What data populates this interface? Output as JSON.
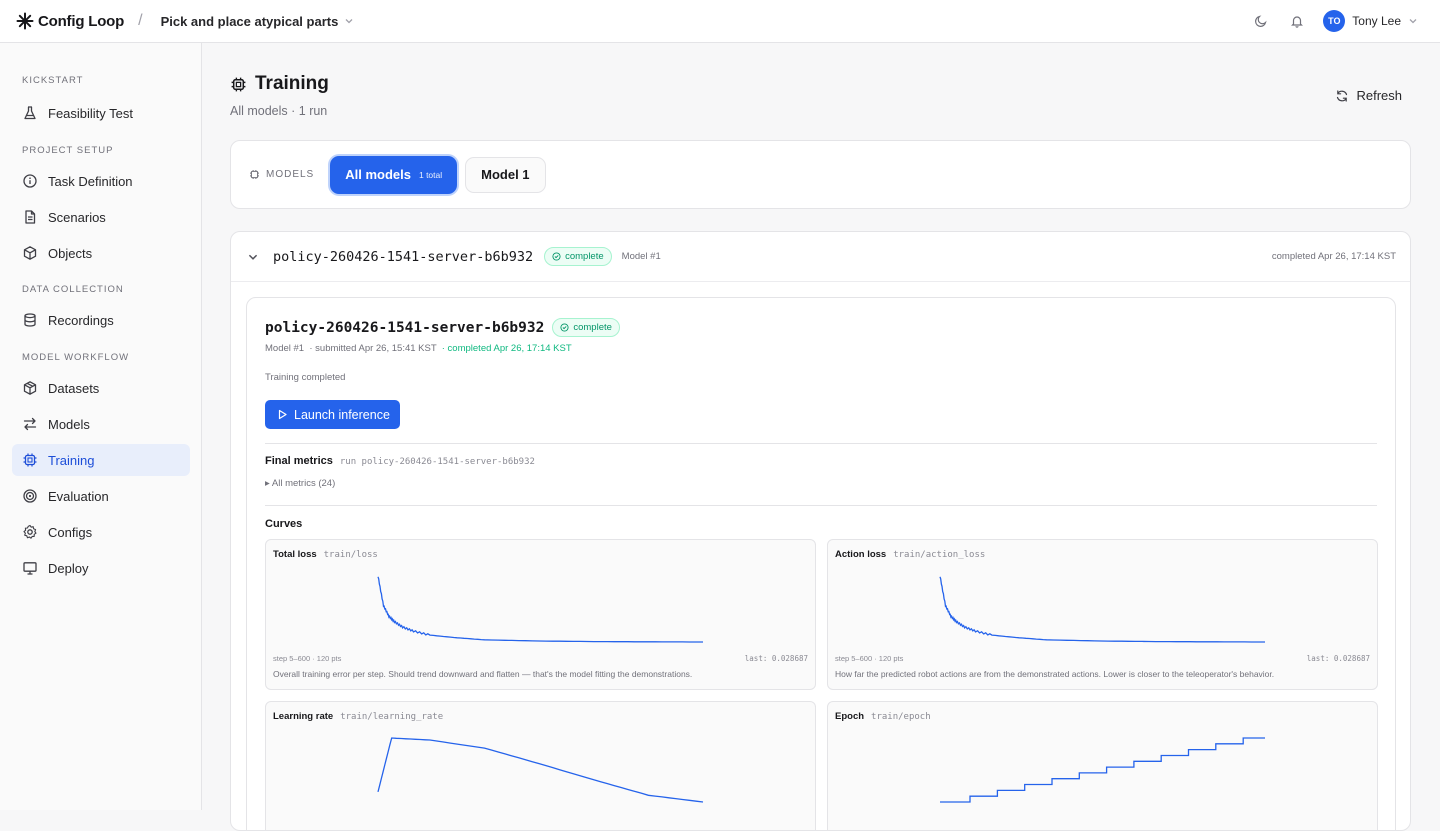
{
  "app": {
    "brand": "Config Loop",
    "separator": "/",
    "project": "Pick and place atypical parts",
    "user_initials": "TO",
    "user_name": "Tony Lee",
    "accent_color": "#2563eb"
  },
  "sidebar": {
    "sections": {
      "kickstart": "KICKSTART",
      "project_setup": "PROJECT SETUP",
      "data_collection": "DATA COLLECTION",
      "model_workflow": "MODEL WORKFLOW"
    },
    "items": {
      "feasibility": "Feasibility Test",
      "task_definition": "Task Definition",
      "scenarios": "Scenarios",
      "objects": "Objects",
      "recordings": "Recordings",
      "datasets": "Datasets",
      "models": "Models",
      "training": "Training",
      "evaluation": "Evaluation",
      "configs": "Configs",
      "deploy": "Deploy"
    },
    "active": "training"
  },
  "page": {
    "title": "Training",
    "subtitle": "All models · 1 run",
    "refresh_label": "Refresh"
  },
  "models_filter": {
    "label": "MODELS",
    "all_label": "All models",
    "all_count": "1 total",
    "model_1": "Model 1"
  },
  "run": {
    "name": "policy-260426-1541-server-b6b932",
    "status": "complete",
    "model_tag": "Model #1",
    "completed_at": "completed Apr 26, 17:14 KST",
    "detail": {
      "model": "Model #1",
      "submitted": "· submitted Apr 26, 15:41 KST",
      "completed": "· completed Apr 26, 17:14 KST",
      "status_text": "Training completed",
      "launch_label": "Launch inference",
      "final_metrics_label": "Final metrics",
      "final_metrics_run": "run policy-260426-1541-server-b6b932",
      "all_metrics": "All metrics (24)",
      "curves_label": "Curves"
    }
  },
  "curves": {
    "total_loss": {
      "title": "Total loss",
      "key": "train/loss",
      "range": "step 5–600 · 120 pts",
      "last": "last: 0.028687",
      "desc": "Overall training error per step. Should trend downward and flatten — that's the model fitting the demonstrations."
    },
    "action_loss": {
      "title": "Action loss",
      "key": "train/action_loss",
      "range": "step 5–600 · 120 pts",
      "last": "last: 0.028687",
      "desc": "How far the predicted robot actions are from the demonstrated actions. Lower is closer to the teleoperator's behavior."
    },
    "learning_rate": {
      "title": "Learning rate",
      "key": "train/learning_rate"
    },
    "epoch": {
      "title": "Epoch",
      "key": "train/epoch"
    }
  },
  "chart_data": [
    {
      "type": "line",
      "title": "Total loss",
      "x": [
        5,
        15,
        25,
        35,
        50,
        70,
        100,
        150,
        200,
        300,
        400,
        500,
        600
      ],
      "y": [
        0.52,
        0.3,
        0.22,
        0.18,
        0.14,
        0.11,
        0.08,
        0.06,
        0.045,
        0.036,
        0.032,
        0.03,
        0.028687
      ],
      "xlim": [
        5,
        600
      ]
    },
    {
      "type": "line",
      "title": "Action loss",
      "x": [
        5,
        15,
        25,
        35,
        50,
        70,
        100,
        150,
        200,
        300,
        400,
        500,
        600
      ],
      "y": [
        0.52,
        0.3,
        0.22,
        0.18,
        0.14,
        0.11,
        0.08,
        0.06,
        0.045,
        0.036,
        0.032,
        0.03,
        0.028687
      ],
      "xlim": [
        5,
        600
      ]
    },
    {
      "type": "line",
      "title": "Learning rate",
      "x": [
        5,
        30,
        100,
        200,
        300,
        400,
        500,
        600
      ],
      "y": [
        0.2,
        1.0,
        0.97,
        0.85,
        0.62,
        0.38,
        0.15,
        0.05
      ],
      "xlim": [
        5,
        600
      ]
    },
    {
      "type": "line",
      "title": "Epoch",
      "step": true,
      "x": [
        5,
        60,
        110,
        160,
        210,
        260,
        310,
        360,
        410,
        460,
        510,
        560,
        600
      ],
      "y": [
        0,
        1,
        2,
        3,
        4,
        5,
        6,
        7,
        8,
        9,
        10,
        11,
        11
      ],
      "xlim": [
        5,
        600
      ]
    }
  ]
}
